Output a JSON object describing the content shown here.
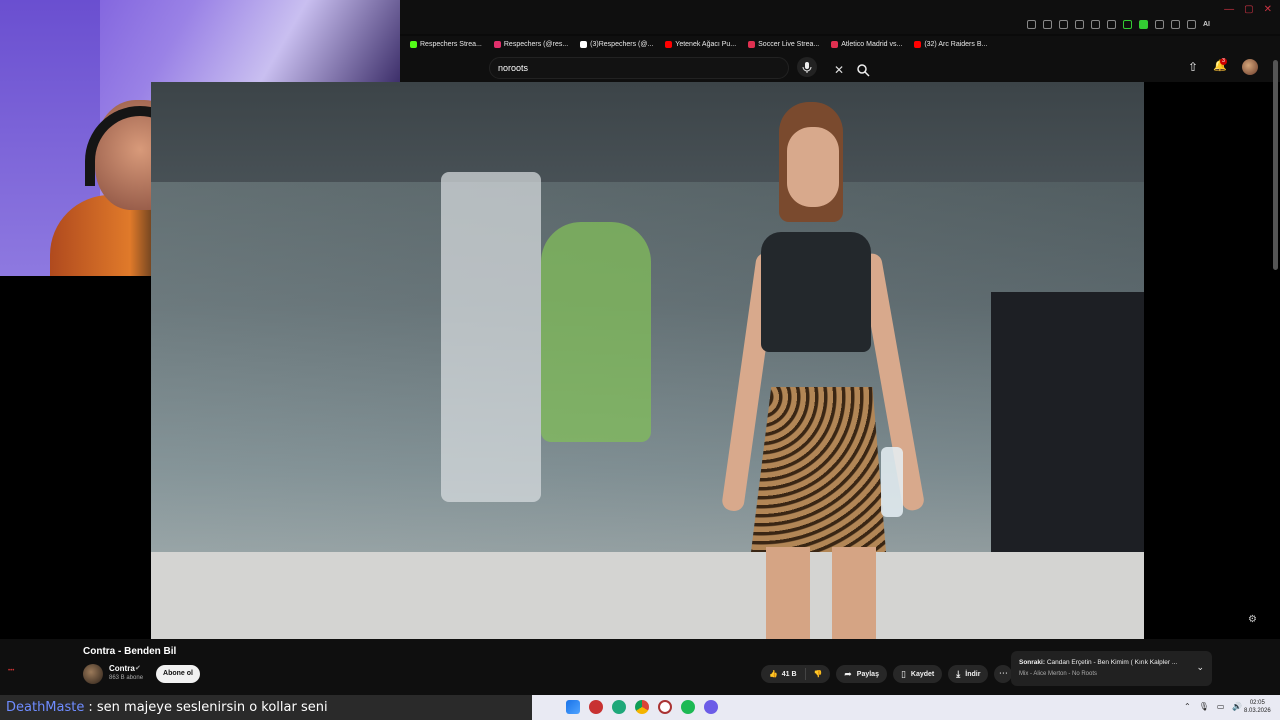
{
  "bookmarks": [
    {
      "label": "Respechers Strea...",
      "color": "#53fc18"
    },
    {
      "label": "Respechers (@res...",
      "color": "#e1306c"
    },
    {
      "label": "(3)Respechers (@...",
      "color": "#ffffff"
    },
    {
      "label": "Yetenek Ağacı Pu...",
      "color": "#ff0000"
    },
    {
      "label": "Soccer Live Strea...",
      "color": "#e03050"
    },
    {
      "label": "Atletico Madrid vs...",
      "color": "#e03050"
    },
    {
      "label": "(32) Arc Raiders B...",
      "color": "#ff0000"
    }
  ],
  "browser": {
    "ai_label": "AI"
  },
  "search": {
    "value": "noroots"
  },
  "notifications": {
    "count": "3"
  },
  "video": {
    "title": "Contra - Benden Bil",
    "channel": "Contra",
    "subscribers": "863 B abone",
    "subscribe_label": "Abone ol",
    "likes": "41 B",
    "share_label": "Paylaş",
    "save_label": "Kaydet",
    "download_label": "İndir"
  },
  "up_next": {
    "prefix": "Sonraki:",
    "title": "Candan Erçetin - Ben Kimim ( Kırık Kalpler ...",
    "subtitle": "Mix - Alice Merton - No Roots"
  },
  "chat": {
    "user": "DeathMaste",
    "message": ": sen majeye seslenirsin o kollar seni"
  },
  "clock": {
    "time": "02:05",
    "date": "8.03.2026"
  },
  "colors": {
    "bg": "#0f0f0f",
    "accent": "#cc0000",
    "chat_user": "#6f8cff"
  }
}
